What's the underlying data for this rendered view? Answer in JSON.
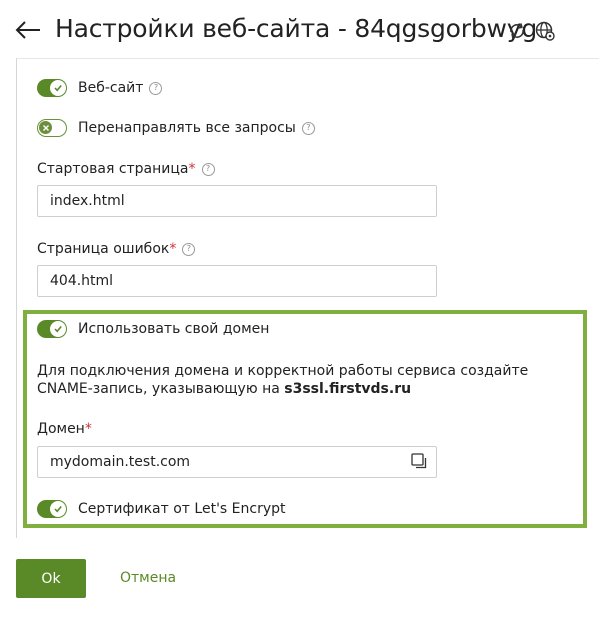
{
  "header": {
    "title": "Настройки веб-сайта - 84qgsgorbwyg",
    "icons": [
      "back-arrow-icon",
      "refresh-icon",
      "globe-settings-icon"
    ]
  },
  "settings": {
    "website": {
      "label": "Веб-сайт",
      "enabled": true
    },
    "redirect_all": {
      "label": "Перенаправлять все запросы",
      "enabled": false
    },
    "start_page": {
      "label": "Стартовая страница",
      "required_mark": "*",
      "value": "index.html"
    },
    "error_page": {
      "label": "Страница ошибок",
      "required_mark": "*",
      "value": "404.html"
    }
  },
  "custom_domain": {
    "toggle_label": "Использовать свой домен",
    "enabled": true,
    "info_text_part1": "Для подключения домена и корректной работы сервиса создайте CNAME-запись, указывающую на ",
    "info_text_host": "s3ssl.firstvds.ru",
    "domain_label": "Домен",
    "required_mark": "*",
    "domain_value": "mydomain.test.com",
    "certificate_label": "Сертификат от Let's Encrypt",
    "certificate_enabled": true
  },
  "help_glyph": "?",
  "actions": {
    "ok_label": "Ok",
    "cancel_label": "Отмена"
  },
  "colors": {
    "accent": "#5a8a28",
    "highlight_border": "#7fb03f",
    "required": "#d0313b"
  }
}
